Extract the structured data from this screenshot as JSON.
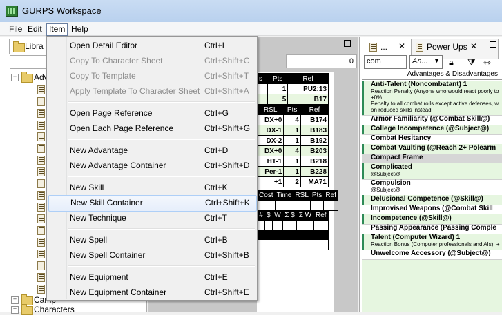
{
  "window": {
    "title": "GURPS Workspace"
  },
  "menubar": [
    {
      "label": "File"
    },
    {
      "label": "Edit"
    },
    {
      "label": "Item"
    },
    {
      "label": "Help"
    }
  ],
  "item_menu": {
    "groups": [
      [
        {
          "label": "Open Detail Editor",
          "shortcut": "Ctrl+I",
          "enabled": true
        },
        {
          "label": "Copy To Character Sheet",
          "shortcut": "Ctrl+Shift+C",
          "enabled": false
        },
        {
          "label": "Copy To Template",
          "shortcut": "Ctrl+Shift+T",
          "enabled": false
        },
        {
          "label": "Apply Template To Character Sheet",
          "shortcut": "Ctrl+Shift+A",
          "enabled": false
        }
      ],
      [
        {
          "label": "Open Page Reference",
          "shortcut": "Ctrl+G",
          "enabled": true
        },
        {
          "label": "Open Each Page Reference",
          "shortcut": "Ctrl+Shift+G",
          "enabled": true
        }
      ],
      [
        {
          "label": "New Advantage",
          "shortcut": "Ctrl+D",
          "enabled": true
        },
        {
          "label": "New Advantage Container",
          "shortcut": "Ctrl+Shift+D",
          "enabled": true
        }
      ],
      [
        {
          "label": "New Skill",
          "shortcut": "Ctrl+K",
          "enabled": true
        },
        {
          "label": "New Skill Container",
          "shortcut": "Ctrl+Shift+K",
          "enabled": true,
          "hover": true
        },
        {
          "label": "New Technique",
          "shortcut": "Ctrl+T",
          "enabled": true
        }
      ],
      [
        {
          "label": "New Spell",
          "shortcut": "Ctrl+B",
          "enabled": true
        },
        {
          "label": "New Spell Container",
          "shortcut": "Ctrl+Shift+B",
          "enabled": true
        }
      ],
      [
        {
          "label": "New Equipment",
          "shortcut": "Ctrl+E",
          "enabled": true
        },
        {
          "label": "New Equipment Container",
          "shortcut": "Ctrl+Shift+E",
          "enabled": true
        }
      ]
    ]
  },
  "library": {
    "tab_label": "Libra",
    "tree_partial_label": "Adv",
    "bottom_items": [
      {
        "label": "Camp"
      },
      {
        "label": "Characters"
      }
    ]
  },
  "sheet": {
    "numeric_field": "0",
    "table1": {
      "headers": [
        "s",
        "Pts",
        "Ref"
      ],
      "rows": [
        [
          "1",
          "PU2:13"
        ],
        [
          "5",
          "B17"
        ]
      ]
    },
    "table2": {
      "headers": [
        "RSL",
        "Pts",
        "Ref"
      ],
      "rows": [
        [
          "DX+0",
          "4",
          "B174"
        ],
        [
          "DX-1",
          "1",
          "B183"
        ],
        [
          "DX-2",
          "1",
          "B192"
        ],
        [
          "DX+0",
          "4",
          "B203"
        ],
        [
          "HT-1",
          "1",
          "B218"
        ],
        [
          "Per-1",
          "1",
          "B228"
        ],
        [
          "+1",
          "2",
          "MA71"
        ]
      ]
    },
    "table3": {
      "headers": [
        "Cost",
        "Time",
        "RSL",
        "Pts",
        "Ref"
      ]
    },
    "table4": {
      "headers": [
        "#",
        "$",
        "W",
        "Σ $",
        "Σ W",
        "Ref"
      ]
    }
  },
  "right_panel": {
    "tab1_label": "...",
    "tab2_label": "Power Ups",
    "search_value": "com",
    "filter_value": "An...",
    "section_header": "Advantages & Disadvantages",
    "items": [
      {
        "name": "Anti-Talent (Noncombatant) 1",
        "notes": [
          "Reaction Penalty (Anyone who would react poorly to",
          "+0%.",
          "Penalty to all combat rolls except active defenses, w",
          "on reduced skills instead"
        ]
      },
      {
        "name": "Armor Familiarity (@Combat Skill@)"
      },
      {
        "name": "College Incompetence (@Subject@)"
      },
      {
        "name": "Combat Hesitancy"
      },
      {
        "name": "Combat Vaulting (@Reach 2+ Polearm"
      },
      {
        "name": "Compact Frame"
      },
      {
        "name": "Complicated",
        "notes": [
          "@Subject@"
        ]
      },
      {
        "name": "Compulsion",
        "notes": [
          "@Subject@"
        ]
      },
      {
        "name": "Delusional Competence (@Skill@)"
      },
      {
        "name": "Improvised Weapons (@Combat Skill"
      },
      {
        "name": "Incompetence (@Skill@)"
      },
      {
        "name": "Passing Appearance (Passing Comple"
      },
      {
        "name": "Talent (Computer Wizard) 1",
        "notes": [
          "Reaction Bonus (Computer professionals and AIs), +"
        ]
      },
      {
        "name": "Unwelcome Accessory (@Subject@)"
      }
    ]
  }
}
